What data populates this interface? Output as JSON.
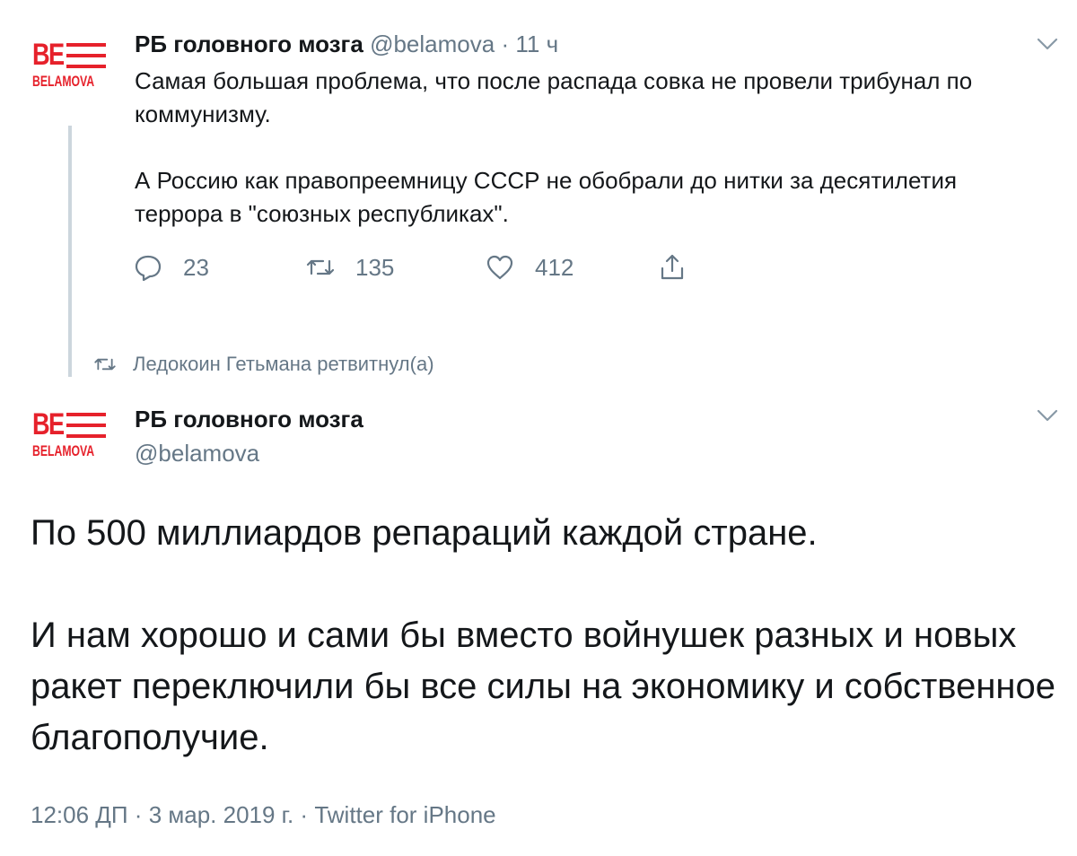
{
  "thread_tweet": {
    "avatar": {
      "monogram": "BE",
      "sub_label": "BELAMOVA",
      "color": "#e6212b"
    },
    "author_name": "РБ головного мозга",
    "handle": "@belamova",
    "separator": "·",
    "time": "11 ч",
    "paragraphs": [
      "Самая большая проблема, что после распада совка не провели трибунал по коммунизму.",
      "А Россию как правопреемницу СССР не обобрали до нитки за десятилетия террора в \"союзных республиках\"."
    ],
    "actions": {
      "reply_count": "23",
      "retweet_count": "135",
      "like_count": "412"
    },
    "menu_icon": "chevron-down-icon"
  },
  "retweet_notice": {
    "icon": "retweet-icon",
    "text": "Ледокоин Гетьмана ретвитнул(а)"
  },
  "main_tweet": {
    "avatar": {
      "monogram": "BE",
      "sub_label": "BELAMOVA",
      "color": "#e6212b"
    },
    "author_name": "РБ головного мозга",
    "handle": "@belamova",
    "paragraphs": [
      "По 500 миллиардов репараций каждой стране.",
      "И нам хорошо и сами бы вместо войнушек разных и новых ракет переключили бы все силы на экономику и собственное благополучие."
    ],
    "meta": "12:06 ДП · 3 мар. 2019 г. · Twitter for iPhone",
    "menu_icon": "chevron-down-icon"
  },
  "colors": {
    "text_primary": "#14171a",
    "text_secondary": "#657786",
    "thread_line": "#ccd6dd",
    "brand_red": "#e6212b"
  }
}
